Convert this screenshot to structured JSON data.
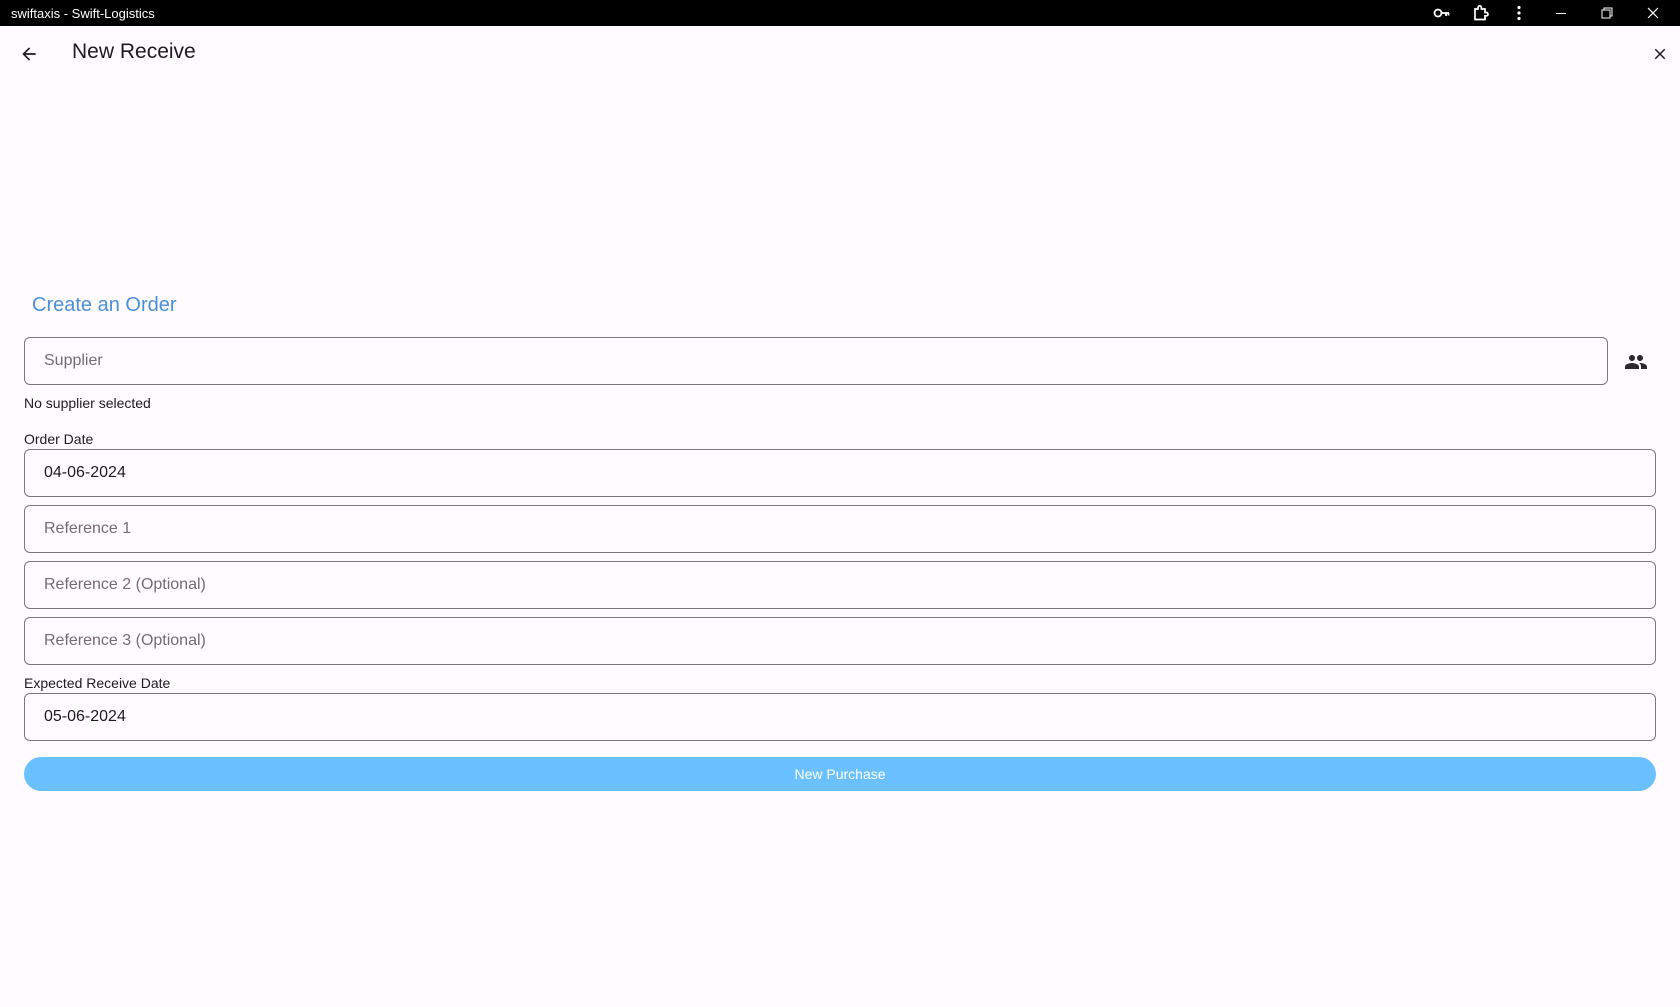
{
  "window": {
    "title": "swiftaxis - Swift-Logistics"
  },
  "appbar": {
    "title": "New Receive"
  },
  "form": {
    "section_title": "Create an Order",
    "supplier": {
      "placeholder": "Supplier",
      "status": "No supplier selected"
    },
    "order_date": {
      "label": "Order Date",
      "value": "04-06-2024"
    },
    "reference1": {
      "placeholder": "Reference 1"
    },
    "reference2": {
      "placeholder": "Reference 2 (Optional)"
    },
    "reference3": {
      "placeholder": "Reference 3 (Optional)"
    },
    "expected_receive_date": {
      "label": "Expected Receive Date",
      "value": "05-06-2024"
    },
    "submit_label": "New Purchase"
  },
  "icons": {
    "titlebar": [
      "key-icon",
      "extension-icon",
      "more-vert-icon",
      "minimize-icon",
      "restore-icon",
      "close-icon"
    ],
    "appbar": [
      "arrow-back-icon",
      "close-icon"
    ],
    "supplier_picker": "people-icon"
  },
  "colors": {
    "background": "#fffbfe",
    "accent_text": "#4a90d9",
    "button": "#6bc1ff",
    "field_border": "#79747e",
    "titlebar": "#000000"
  }
}
